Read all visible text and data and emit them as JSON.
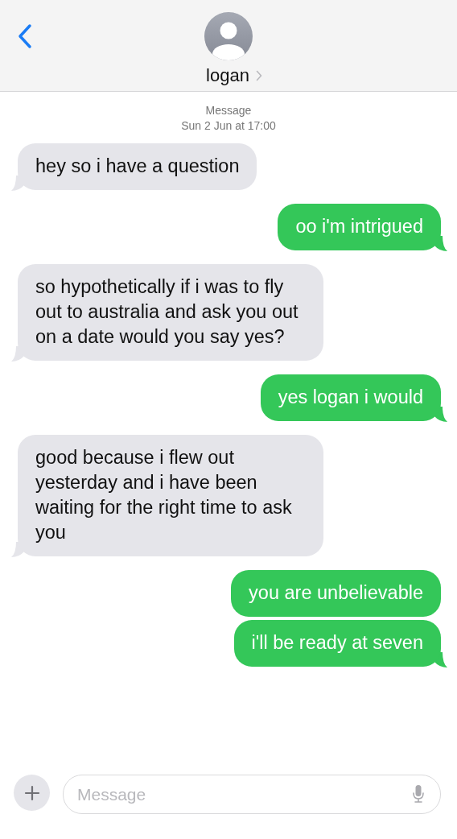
{
  "header": {
    "contact_name": "logan"
  },
  "thread_info": {
    "service": "Message",
    "timestamp": "Sun 2 Jun at 17:00"
  },
  "messages": [
    {
      "kind": "incoming",
      "text": "hey so i have a question",
      "tail": true
    },
    {
      "kind": "outgoing",
      "text": "oo i'm intrigued",
      "tail": true
    },
    {
      "kind": "incoming",
      "text": "so hypothetically if i was to fly out to australia and ask you out on a date would you say yes?",
      "tail": true
    },
    {
      "kind": "outgoing",
      "text": "yes logan i would",
      "tail": true
    },
    {
      "kind": "incoming",
      "text": "good because i flew out yesterday and i have been waiting for the right time to ask you",
      "tail": true
    },
    {
      "kind": "outgoing",
      "text": "you are unbelievable",
      "tail": false
    },
    {
      "kind": "outgoing",
      "text": "i'll be ready at seven",
      "tail": true
    }
  ],
  "composer": {
    "placeholder": "Message"
  }
}
